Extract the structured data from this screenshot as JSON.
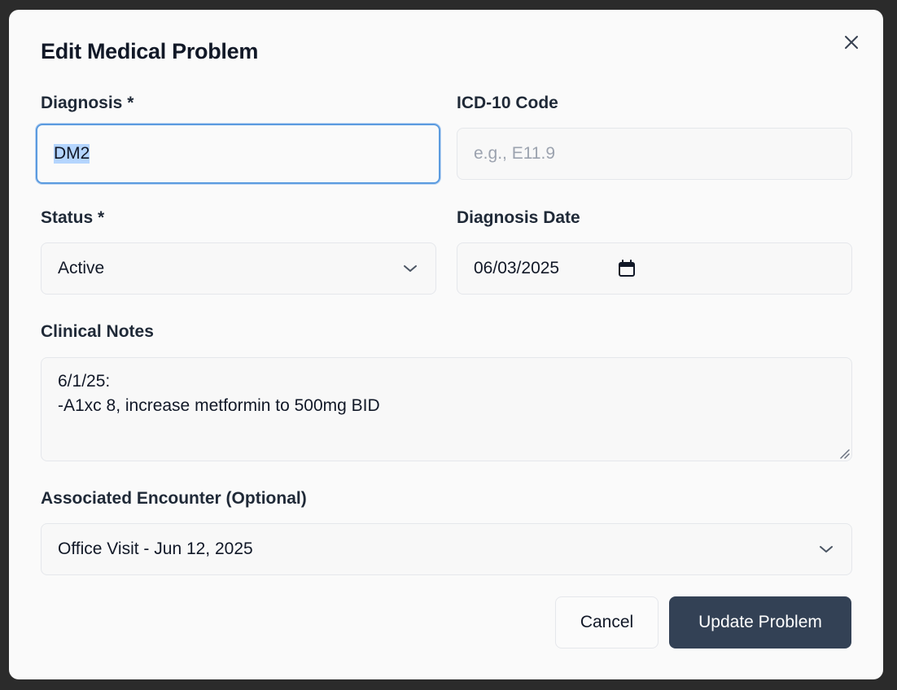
{
  "dialog": {
    "title": "Edit Medical Problem",
    "close_icon": "close-icon"
  },
  "form": {
    "diagnosis": {
      "label": "Diagnosis *",
      "value": "DM2"
    },
    "icd10": {
      "label": "ICD-10 Code",
      "value": "",
      "placeholder": "e.g., E11.9"
    },
    "status": {
      "label": "Status *",
      "value": "Active",
      "icon": "chevron-down-icon"
    },
    "diagnosis_date": {
      "label": "Diagnosis Date",
      "value": "06/03/2025",
      "icon": "calendar-icon"
    },
    "clinical_notes": {
      "label": "Clinical Notes",
      "value": "6/1/25:\n-A1xc 8, increase metformin to 500mg BID"
    },
    "encounter": {
      "label": "Associated Encounter (Optional)",
      "value": "Office Visit - Jun 12, 2025",
      "icon": "chevron-down-icon"
    }
  },
  "actions": {
    "cancel_label": "Cancel",
    "submit_label": "Update Problem"
  },
  "colors": {
    "primary_button": "#334155",
    "focus_ring": "#5b9bdf",
    "text_selection": "#b4d5fe"
  }
}
